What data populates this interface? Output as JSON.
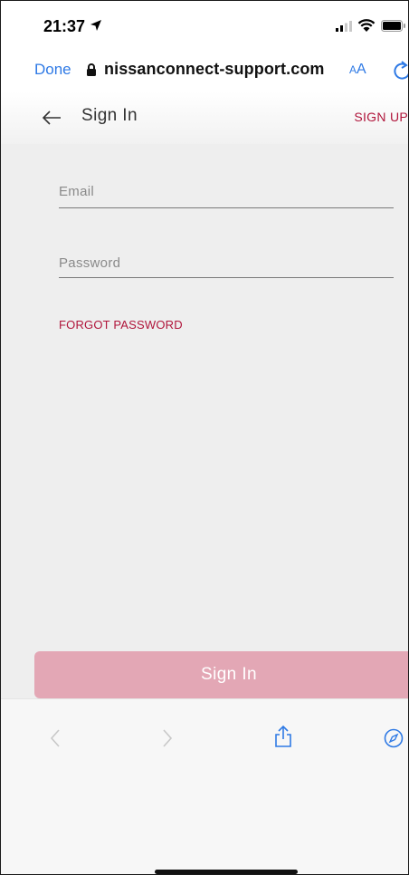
{
  "status_bar": {
    "time": "21:37"
  },
  "browser": {
    "done_label": "Done",
    "domain": "nissanconnect-support.com",
    "text_size_small": "A",
    "text_size_large": "A"
  },
  "header": {
    "title": "Sign In",
    "signup_label": "SIGN UP"
  },
  "form": {
    "email_placeholder": "Email",
    "password_placeholder": "Password",
    "forgot_label": "FORGOT PASSWORD",
    "submit_label": "Sign In"
  },
  "icons": {
    "back": "arrow-left-icon",
    "location": "location-arrow-icon",
    "signal": "signal-icon",
    "wifi": "wifi-icon",
    "battery": "battery-icon",
    "lock": "lock-icon",
    "reload": "reload-icon",
    "browser_back": "chevron-left-icon",
    "browser_forward": "chevron-right-icon",
    "share": "share-icon",
    "compass": "compass-icon"
  },
  "colors": {
    "accent": "#b0153b",
    "button_disabled": "#e3a7b5",
    "ios_blue": "#2f7ae5",
    "page_bg": "#eeeeee"
  }
}
